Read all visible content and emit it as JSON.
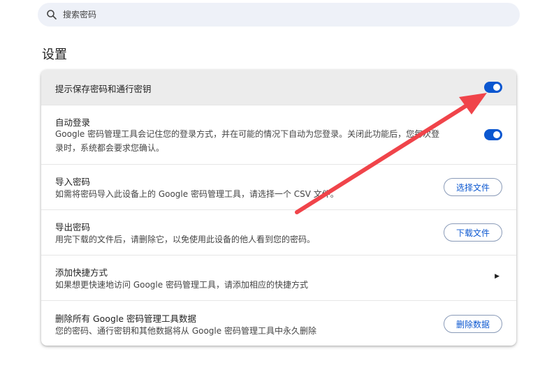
{
  "search": {
    "placeholder": "搜索密码",
    "icon": "search-icon"
  },
  "settings_title": "设置",
  "rows": {
    "offer_save": {
      "title": "提示保存密码和通行密钥",
      "toggle_on": true
    },
    "auto_signin": {
      "title": "自动登录",
      "desc_line1": "Google 密码管理工具会记住您的登录方式，并在可能的情况下自动为您登录。关闭此功能后，您每次登",
      "desc_line2": "录时，系统都会要求您确认。",
      "toggle_on": true
    },
    "import": {
      "title": "导入密码",
      "desc": "如需将密码导入此设备上的 Google 密码管理工具，请选择一个 CSV 文件。",
      "button": "选择文件"
    },
    "export": {
      "title": "导出密码",
      "desc": "用完下载的文件后，请删除它，以免使用此设备的他人看到您的密码。",
      "button": "下载文件"
    },
    "shortcut": {
      "title": "添加快捷方式",
      "desc": "如果想更快速地访问 Google 密码管理工具，请添加相应的快捷方式",
      "icon": "chevron-right-icon"
    },
    "delete": {
      "title": "删除所有 Google 密码管理工具数据",
      "desc": "您的密码、通行密钥和其他数据将从 Google 密码管理工具中永久删除",
      "button": "删除数据"
    }
  },
  "colors": {
    "accent": "#0b57d0",
    "annotation_arrow": "#f0444a"
  }
}
